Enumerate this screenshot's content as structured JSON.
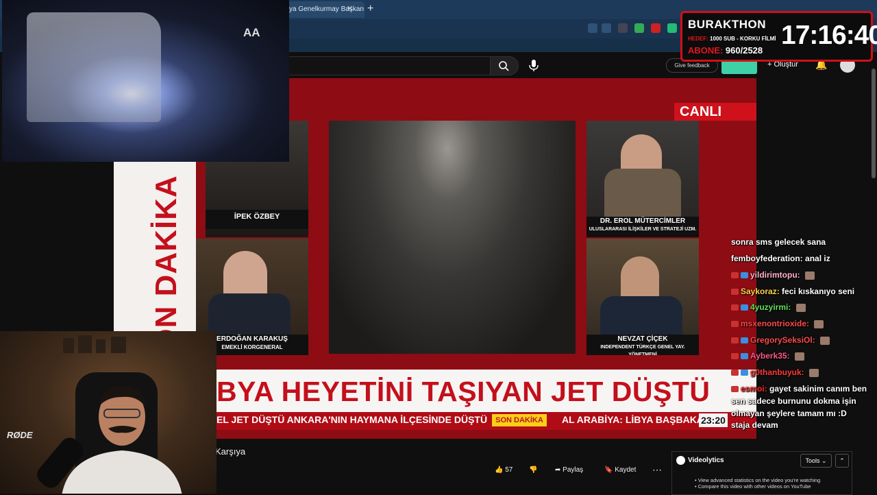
{
  "browser": {
    "tab_title": "ya Genelkurmay Başkanı'n",
    "tab_close": "✕",
    "new_tab": "+"
  },
  "youtube": {
    "feedback": "Give feedback",
    "create": "Oluştur",
    "notifications_badge": "9+",
    "video_title": "Karşıya",
    "actions": {
      "likes": "57",
      "share": "Paylaş",
      "save": "Kaydet",
      "more": "⋯"
    }
  },
  "broadcast": {
    "live_label": "CANLI",
    "vertical_banner": "SON DAKİKA",
    "headline": "BYA HEYETİNİ TAŞIYAN JET DÜŞTÜ",
    "ticker_left": "EL JET DÜŞTÜ ANKARA'NIN HAYMANA İLÇESİNDE DÜŞTÜ",
    "ticker_tag": "SON DAKİKA",
    "ticker_right": "AL ARABİYA: LİBYA BAŞBAKA",
    "clock": "23:20",
    "panelists": [
      {
        "name": "İPEK ÖZBEY",
        "title": ""
      },
      {
        "name": "DR. EROL MÜTERCİMLER",
        "title": "ULUSLARARASI İLİŞKİLER VE STRATEJİ UZM."
      },
      {
        "name": "ERDOĞAN KARAKUŞ",
        "title": "EMEKLİ KORGENERAL"
      },
      {
        "name": "NEVZAT ÇİÇEK",
        "title": "INDEPENDENT TÜRKÇE GENEL YAY. YÖNETMENİ"
      }
    ]
  },
  "chat": {
    "messages": [
      {
        "user": "",
        "text": "sonra sms gelecek sana",
        "color": "#ffffff",
        "badges": 0,
        "emote": false
      },
      {
        "user": "femboyfederation:",
        "text": "anal iz",
        "color": "#ffffff",
        "badges": 0,
        "emote": false
      },
      {
        "user": "yildirimtopu:",
        "text": "",
        "color": "#ffb3c8",
        "badges": 2,
        "emote": true
      },
      {
        "user": "Saykoraz:",
        "text": "feci kıskanıyo seni",
        "color": "#ffd24a",
        "badges": 1,
        "emote": false
      },
      {
        "user": "4yuzyirmi:",
        "text": "",
        "color": "#62e05a",
        "badges": 2,
        "emote": true
      },
      {
        "user": "msxenontrioxide:",
        "text": "",
        "color": "#ff4a4a",
        "badges": 1,
        "emote": true
      },
      {
        "user": "GregorySeksiOl:",
        "text": "",
        "color": "#ff4a4a",
        "badges": 2,
        "emote": true
      },
      {
        "user": "Ayberk35:",
        "text": "",
        "color": "#ff5a8a",
        "badges": 2,
        "emote": true
      },
      {
        "user": "g0thanbuyuk:",
        "text": "",
        "color": "#ff3a3a",
        "badges": 2,
        "emote": true
      },
      {
        "user": "esmoi:",
        "text": "gayet sakinim canım ben",
        "color": "#ff2a2a",
        "badges": 1,
        "emote": false
      },
      {
        "user": "",
        "text": "sen sadece burnunu dokma işin",
        "color": "#ffffff",
        "badges": 0,
        "emote": false
      },
      {
        "user": "",
        "text": "olmayan şeylere tamam mı :D",
        "color": "#ffffff",
        "badges": 0,
        "emote": false
      },
      {
        "user": "",
        "text": "staja devam",
        "color": "#ffffff",
        "badges": 0,
        "emote": false
      }
    ]
  },
  "videolytics": {
    "title": "Videolytics",
    "tools": "Tools ⌄",
    "bullet1": "View advanced statistics on the video you're watching",
    "bullet2": "Compare this video with other videos on YouTube"
  },
  "overlay": {
    "burakthon_title": "BURAKTHON",
    "hedef_label": "HEDEF:",
    "hedef_text": "1000 SUB - KORKU FİLMİ",
    "abone_label": "ABONE:",
    "abone_value": "960/2528",
    "timer": "17:16:40",
    "mic_brand": "RØDE",
    "aa_logo": "AA"
  }
}
